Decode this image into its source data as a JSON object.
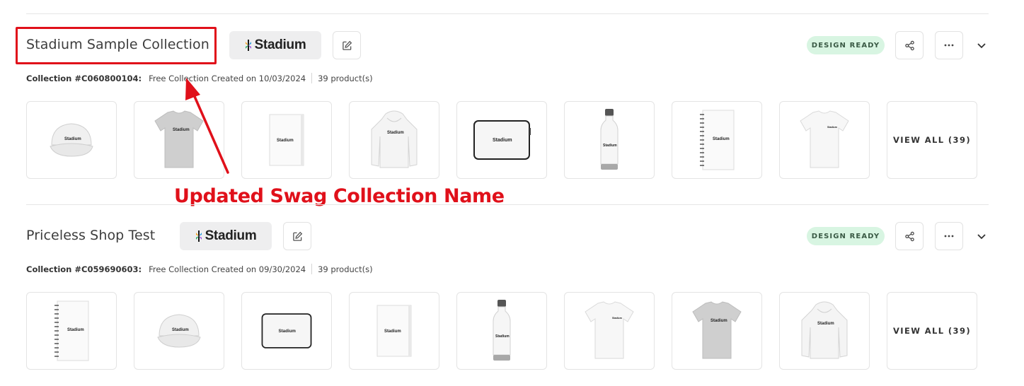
{
  "collections": [
    {
      "name": "Stadium Sample Collection",
      "brand": "Stadium",
      "status": "DESIGN READY",
      "collection_id": "Collection #C060800104:",
      "created": "Free Collection Created on 10/03/2024",
      "count": "39 product(s)",
      "products": [
        "cap",
        "tshirt-gray",
        "notebook",
        "hoodie",
        "laptop-sleeve",
        "bottle",
        "spiral-notebook",
        "tshirt-white"
      ],
      "view_all": "VIEW ALL (39)"
    },
    {
      "name": "Priceless Shop Test",
      "brand": "Stadium",
      "status": "DESIGN READY",
      "collection_id": "Collection #C059690603:",
      "created": "Free Collection Created on 09/30/2024",
      "count": "39 product(s)",
      "products": [
        "spiral-notebook",
        "cap",
        "laptop-sleeve",
        "notebook",
        "bottle",
        "tshirt-white",
        "tshirt-gray",
        "hoodie"
      ],
      "view_all": "VIEW ALL (39)"
    }
  ],
  "annotation": {
    "text": "Updated Swag Collection Name",
    "color": "#e0101a"
  },
  "colors": {
    "badge_bg": "#d8f5e2",
    "pill_bg": "#eeeeef",
    "accent_red": "#e0101a"
  },
  "icons": {
    "edit": "pencil-square-icon",
    "share": "share-icon",
    "more": "ellipsis-icon",
    "expand": "chevron-down-icon"
  }
}
